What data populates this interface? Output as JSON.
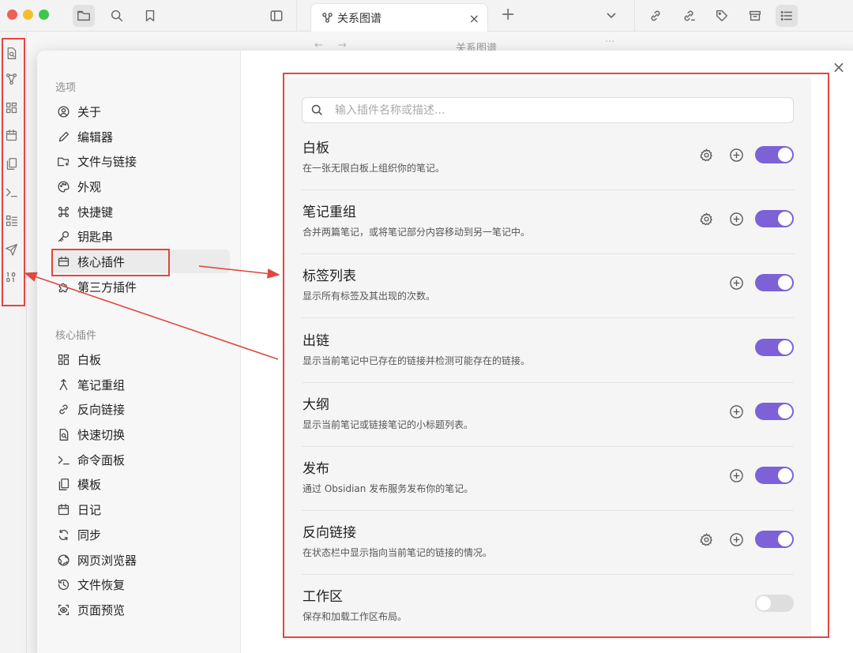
{
  "colors": {
    "accent": "#7c62d6",
    "annotation_red": "#e0473f",
    "traffic_red": "#ee5f57",
    "traffic_yellow": "#f6be2e",
    "traffic_green": "#3ec74a"
  },
  "titlebar": {
    "tab_title": "关系图谱",
    "tab_close": "×",
    "new_tab": "+",
    "left_icons": [
      "files-icon",
      "search-icon",
      "bookmark-icon",
      "sidebar-toggle-icon"
    ],
    "right_icons": [
      "backlinks-icon",
      "outgoing-links-icon",
      "tags-icon",
      "archive-icon",
      "outline-icon"
    ]
  },
  "subbar": {
    "graph_title": "关系图谱"
  },
  "ribbon_icons": [
    "quick-switch-icon",
    "graph-icon",
    "canvas-icon",
    "daily-note-icon",
    "template-icon",
    "command-palette-icon",
    "outline-list-icon",
    "publish-icon",
    "binary-icon"
  ],
  "modal": {
    "close": "×"
  },
  "settings": {
    "options_title": "选项",
    "options": [
      {
        "label": "关于",
        "icon": "user-circle-icon"
      },
      {
        "label": "编辑器",
        "icon": "pencil-icon"
      },
      {
        "label": "文件与链接",
        "icon": "folder-link-icon"
      },
      {
        "label": "外观",
        "icon": "palette-icon"
      },
      {
        "label": "快捷键",
        "icon": "command-key-icon"
      },
      {
        "label": "钥匙串",
        "icon": "key-icon"
      },
      {
        "label": "核心插件",
        "icon": "calendar-plugin-icon",
        "active": true
      },
      {
        "label": "第三方插件",
        "icon": "puzzle-icon"
      }
    ],
    "core_title": "核心插件",
    "core_plugins": [
      {
        "label": "白板",
        "icon": "canvas-icon"
      },
      {
        "label": "笔记重组",
        "icon": "merge-icon"
      },
      {
        "label": "反向链接",
        "icon": "backlink-icon"
      },
      {
        "label": "快速切换",
        "icon": "quick-switch-icon"
      },
      {
        "label": "命令面板",
        "icon": "terminal-icon"
      },
      {
        "label": "模板",
        "icon": "copy-icon"
      },
      {
        "label": "日记",
        "icon": "calendar-icon"
      },
      {
        "label": "同步",
        "icon": "sync-icon"
      },
      {
        "label": "网页浏览器",
        "icon": "globe-icon"
      },
      {
        "label": "文件恢复",
        "icon": "history-icon"
      },
      {
        "label": "页面预览",
        "icon": "preview-icon"
      }
    ]
  },
  "search": {
    "placeholder": "输入插件名称或描述..."
  },
  "plugins": [
    {
      "name": "白板",
      "desc": "在一张无限白板上组织你的笔记。",
      "gear": true,
      "plus": true,
      "enabled": true
    },
    {
      "name": "笔记重组",
      "desc": "合并两篇笔记，或将笔记部分内容移动到另一笔记中。",
      "gear": true,
      "plus": true,
      "enabled": true
    },
    {
      "name": "标签列表",
      "desc": "显示所有标签及其出现的次数。",
      "gear": false,
      "plus": true,
      "enabled": true
    },
    {
      "name": "出链",
      "desc": "显示当前笔记中已存在的链接并检测可能存在的链接。",
      "gear": false,
      "plus": false,
      "enabled": true
    },
    {
      "name": "大纲",
      "desc": "显示当前笔记或链接笔记的小标题列表。",
      "gear": false,
      "plus": true,
      "enabled": true
    },
    {
      "name": "发布",
      "desc": "通过 Obsidian 发布服务发布你的笔记。",
      "gear": false,
      "plus": true,
      "enabled": true
    },
    {
      "name": "反向链接",
      "desc": "在状态栏中显示指向当前笔记的链接的情况。",
      "gear": true,
      "plus": true,
      "enabled": true
    },
    {
      "name": "工作区",
      "desc": "保存和加载工作区布局。",
      "gear": false,
      "plus": false,
      "enabled": false
    }
  ]
}
